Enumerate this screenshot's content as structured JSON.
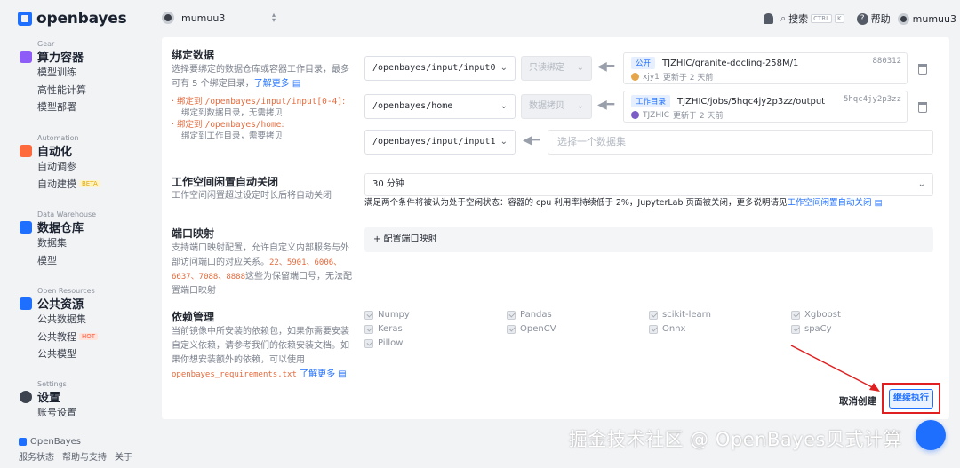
{
  "brand": {
    "logo_text": "openbayes"
  },
  "sidebar": {
    "groups": [
      {
        "caption": "Gear",
        "title": "算力容器",
        "icon": "cube-icon",
        "icon_color": "#8e5cf6",
        "items": [
          {
            "label": "模型训练"
          },
          {
            "label": "高性能计算"
          },
          {
            "label": "模型部署"
          }
        ]
      },
      {
        "caption": "Automation",
        "title": "自动化",
        "icon": "automation-icon",
        "icon_color": "#ff6a3d",
        "items": [
          {
            "label": "自动调参"
          },
          {
            "label": "自动建模",
            "badge": "BETA"
          }
        ]
      },
      {
        "caption": "Data Warehouse",
        "title": "数据仓库",
        "icon": "database-icon",
        "icon_color": "#1f6fff",
        "items": [
          {
            "label": "数据集"
          },
          {
            "label": "模型"
          }
        ]
      },
      {
        "caption": "Open Resources",
        "title": "公共资源",
        "icon": "share-icon",
        "icon_color": "#1f6fff",
        "items": [
          {
            "label": "公共数据集"
          },
          {
            "label": "公共教程",
            "badge": "HOT"
          },
          {
            "label": "公共模型"
          }
        ]
      },
      {
        "caption": "Settings",
        "title": "设置",
        "icon": "gear-icon",
        "icon_color": "#3d434f",
        "items": [
          {
            "label": "账号设置"
          }
        ]
      }
    ],
    "footer": {
      "brand": "OpenBayes",
      "links": [
        "服务状态",
        "帮助与支持",
        "关于"
      ]
    }
  },
  "topbar": {
    "user": "mumuu3",
    "search_label": "搜索",
    "search_kbd": [
      "CTRL",
      "K"
    ],
    "help_label": "帮助",
    "account": "mumuu3"
  },
  "bind_data": {
    "title": "绑定数据",
    "desc": "选择要绑定的数据仓库或容器工作目录，最多可有 5 个绑定目录，",
    "learn_more": "了解更多",
    "note1_prefix": "绑定到",
    "note1_path": "/openbayes/input/input[0-4]",
    "note1_suffix": "绑定到数据目录，无需拷贝",
    "note2_prefix": "绑定到",
    "note2_path": "/openbayes/home",
    "note2_suffix": "绑定到工作目录，需要拷贝",
    "rows": [
      {
        "path": "/openbayes/input/input0",
        "mode": "只读绑定",
        "tag": "公开",
        "name": "TJZHIC/granite-docling-258M/1",
        "owner": "xjy1",
        "updated": "更新于 2 天前",
        "hash": "880312"
      },
      {
        "path": "/openbayes/home",
        "mode": "数据拷贝",
        "tag": "工作目录",
        "name": "TJZHIC/jobs/5hqc4jy2p3zz/output",
        "owner": "TJZHIC",
        "updated": "更新于 2 天前",
        "hash": "5hqc4jy2p3zz"
      },
      {
        "path": "/openbayes/input/input1",
        "placeholder": "选择一个数据集"
      }
    ]
  },
  "idle": {
    "title": "工作空间闲置自动关闭",
    "desc": "工作空间闲置超过设定时长后将自动关闭",
    "value": "30 分钟",
    "note": "满足两个条件将被认为处于空闲状态：容器的 cpu 利用率持续低于 2%，JupyterLab 页面被关闭，更多说明请见",
    "note_link": "工作空间闲置自动关闭"
  },
  "ports": {
    "title": "端口映射",
    "desc": "支持端口映射配置，允许自定义内部服务与外部访问端口的对应关系。",
    "reserved": "22、5901、6006、6637、7088、8888",
    "desc_suffix": "这些为保留端口号，无法配置端口映射",
    "add_label": "+ 配置端口映射"
  },
  "deps": {
    "title": "依赖管理",
    "desc": "当前镜像中所安装的依赖包，如果你需要安装自定义依赖，请参考我们的依赖安装文档。如果你想安装额外的依赖，可以使用",
    "file": "openbayes_requirements.txt",
    "learn_more": "了解更多",
    "items": [
      "Numpy",
      "Pandas",
      "scikit-learn",
      "Xgboost",
      "Keras",
      "OpenCV",
      "Onnx",
      "spaCy",
      "Pillow"
    ]
  },
  "actions": {
    "cancel": "取消创建",
    "continue": "继续执行"
  },
  "watermark": "掘金技术社区 @ OpenBayes贝式计算"
}
